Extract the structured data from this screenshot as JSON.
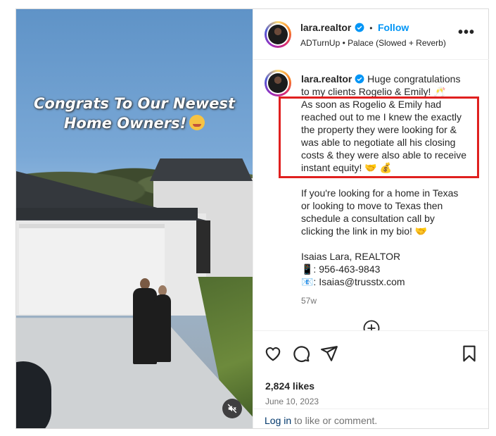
{
  "media": {
    "overlay_line1": "Congrats To Our Newest",
    "overlay_line2": "Home Owners!",
    "overlay_emoji": "partying-face"
  },
  "header": {
    "username": "lara.realtor",
    "separator": "•",
    "follow_label": "Follow",
    "audio_text": "ADTurnUp • Palace (Slowed + Reverb)",
    "more_label": "•••"
  },
  "caption": {
    "username": "lara.realtor",
    "intro_line1": "Huge congratulations",
    "intro_line2": "to my clients Rogelio & Emily! 🥂",
    "highlighted_lines": [
      "As soon as Rogelio & Emily had",
      "reached out to me I knew the exactly",
      "the property they were looking for &",
      "was able to negotiate all his closing",
      "costs & they were also able to receive",
      "instant equity! 🤝 💰"
    ],
    "paragraph2_lines": [
      "If you're looking for a home in Texas",
      "or looking to move to Texas then",
      "schedule a consultation call by",
      "clicking the link in my bio! 🤝"
    ],
    "signature": "Isaias Lara, REALTOR",
    "phone": "📱: 956-463-9843",
    "email": "📧: Isaias@trusstx.com",
    "time_ago": "57w"
  },
  "actions": {
    "likes": "2,824 likes",
    "date": "June 10, 2023"
  },
  "login": {
    "link": "Log in",
    "rest": " to like or comment."
  },
  "colors": {
    "accent": "#0095f6",
    "highlight_border": "#e0201f"
  }
}
